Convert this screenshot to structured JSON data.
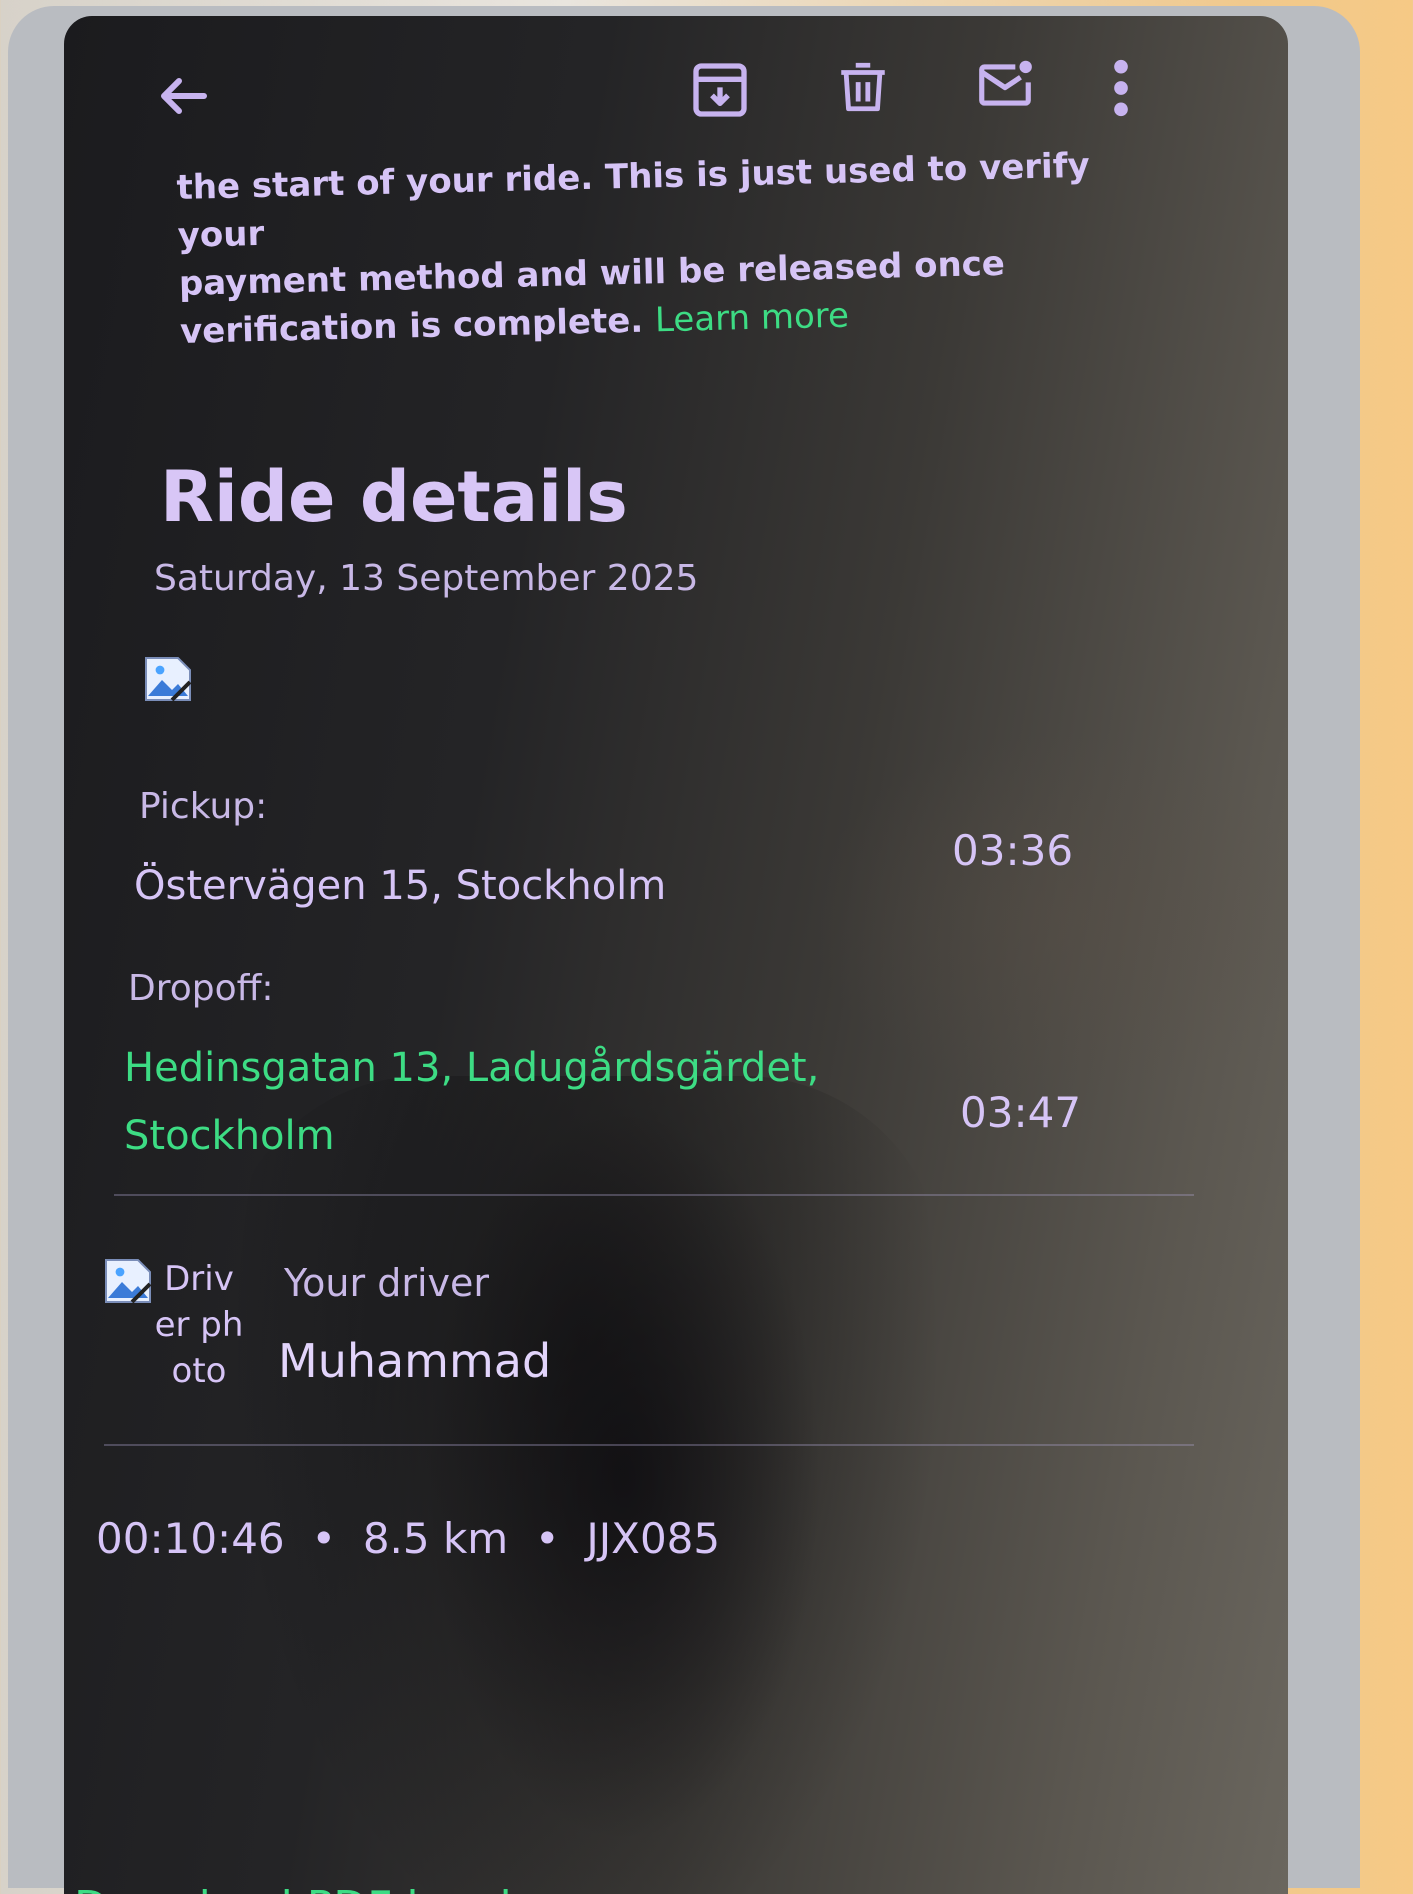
{
  "toolbar": {
    "back_icon": "arrow-left-icon",
    "archive_icon": "archive-icon",
    "delete_icon": "trash-icon",
    "unread_icon": "mail-unread-icon",
    "more_icon": "more-vertical-icon"
  },
  "notice": {
    "line1": "the start of your ride. This is just used to verify your",
    "line2": "payment method and will be released once",
    "line3": "verification is complete.",
    "link": "Learn more"
  },
  "ride": {
    "title": "Ride details",
    "date": "Saturday, 13 September 2025",
    "pickup_label": "Pickup:",
    "pickup_address": "Östervägen 15, Stockholm",
    "pickup_time": "03:36",
    "dropoff_label": "Dropoff:",
    "dropoff_line1": "Hedinsgatan 13, Ladugårdsgärdet,",
    "dropoff_line2": "Stockholm",
    "dropoff_time": "03:47"
  },
  "driver": {
    "photo_alt": "Driver photo",
    "label": "Your driver",
    "name": "Muhammad"
  },
  "trip": {
    "duration": "00:10:46",
    "separator": "•",
    "distance": "8.5 km",
    "plate": "JJX085"
  },
  "footer": {
    "download_link": "Download PDF invoice"
  },
  "colors": {
    "accent_lilac": "#d6c4f6",
    "link_green": "#3ddc84",
    "icon_lilac": "#c7b3ef"
  }
}
